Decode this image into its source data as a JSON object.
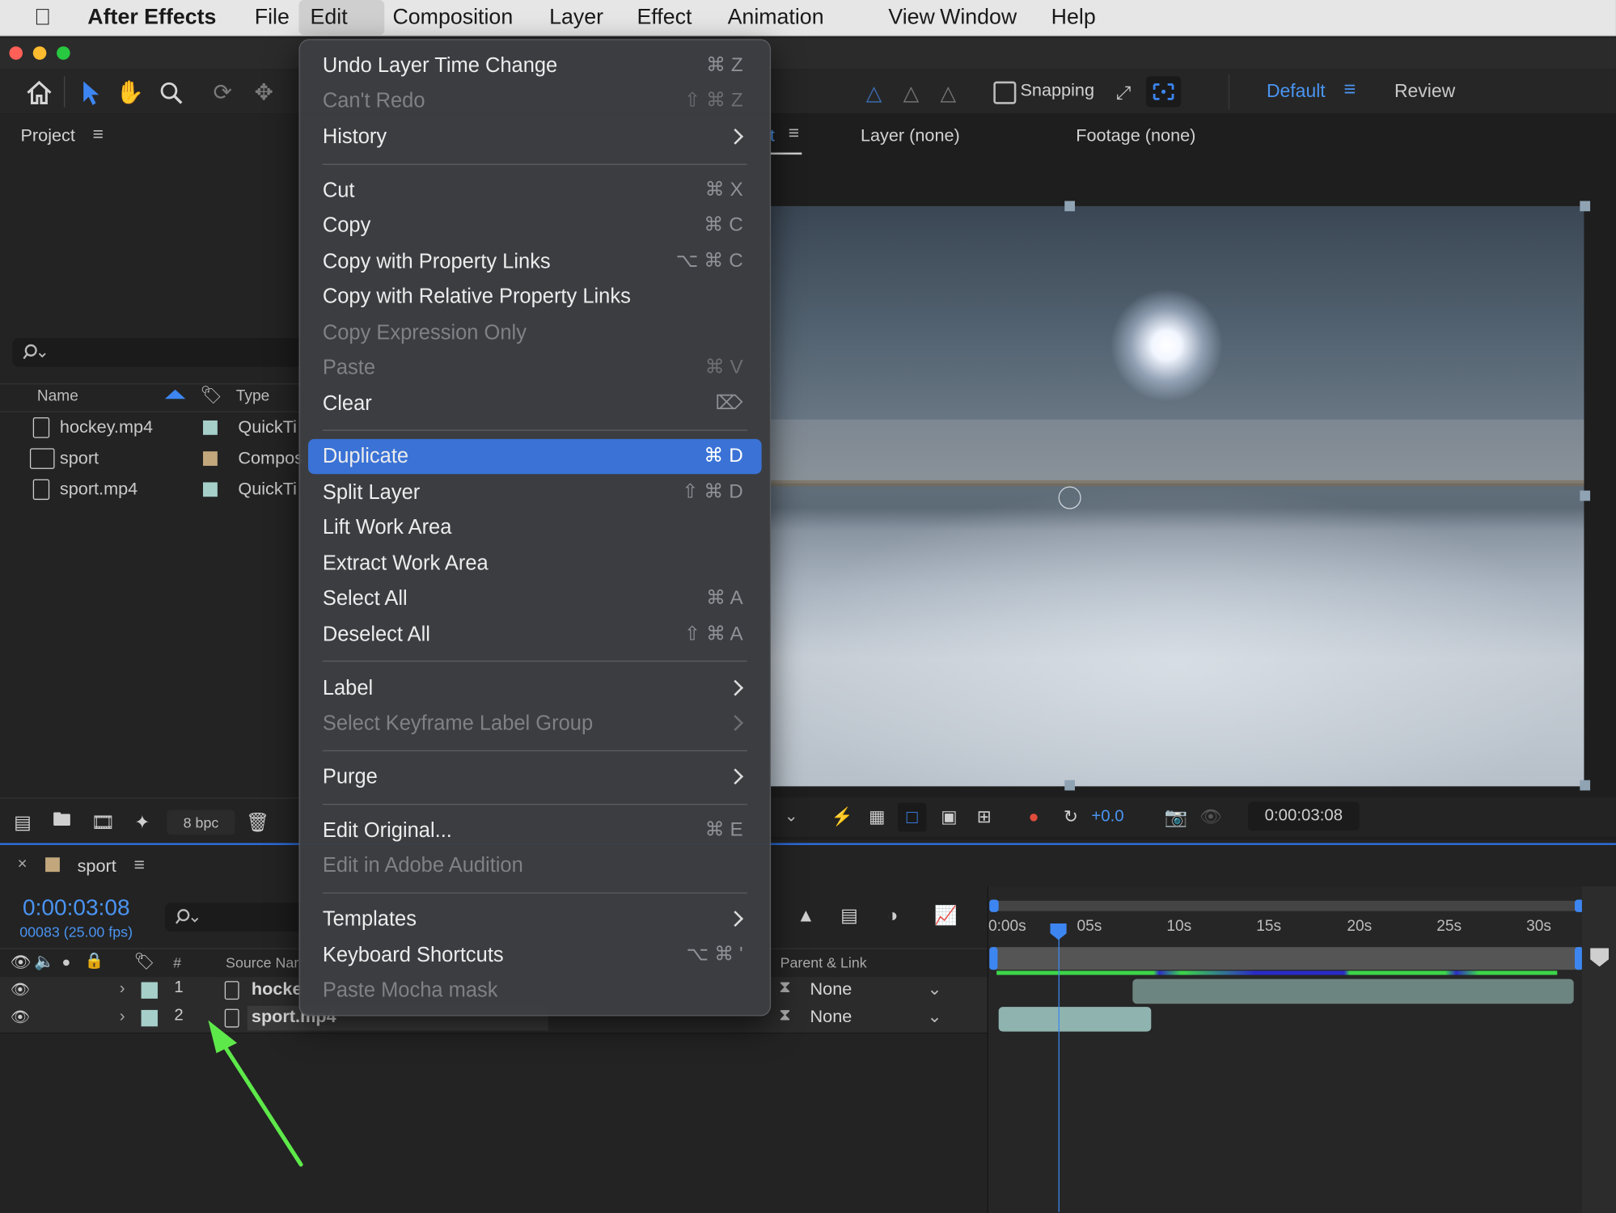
{
  "menubar": {
    "app": "After Effects",
    "items": [
      "File",
      "Edit",
      "Composition",
      "Layer",
      "Effect",
      "Animation",
      "View",
      "Window",
      "Help"
    ]
  },
  "toolbar": {
    "snapping": "Snapping",
    "workspace_default": "Default",
    "workspace_review": "Review"
  },
  "viewer_tabs": {
    "layer": "Layer (none)",
    "footage": "Footage (none)",
    "comp_tab_fragment": "t"
  },
  "project": {
    "title": "Project",
    "columns": {
      "name": "Name",
      "type": "Type"
    },
    "items": [
      {
        "name": "hockey.mp4",
        "type": "QuickTi",
        "color": "#a6cfc9"
      },
      {
        "name": "sport",
        "type": "Compos",
        "color": "#c2a77d"
      },
      {
        "name": "sport.mp4",
        "type": "QuickTi",
        "color": "#a6cfc9"
      }
    ],
    "bpc": "8 bpc"
  },
  "viewer_controls": {
    "exposure": "+0.0",
    "timecode": "0:00:03:08"
  },
  "timeline": {
    "comp_name": "sport",
    "timecode": "0:00:03:08",
    "frames": "00083 (25.00 fps)",
    "col_number": "#",
    "col_source": "Source Nar",
    "col_parent": "Parent & Link",
    "ruler": [
      "0:00s",
      "05s",
      "10s",
      "15s",
      "20s",
      "25s",
      "30s"
    ],
    "layers": [
      {
        "num": "1",
        "name": "hocke",
        "parent": "None"
      },
      {
        "num": "2",
        "name": "sport.mp4",
        "parent": "None"
      }
    ]
  },
  "edit_menu": {
    "items": [
      {
        "label": "Undo Layer Time Change",
        "shortcut": "⌘ Z",
        "disabled": false
      },
      {
        "label": "Can't Redo",
        "shortcut": "⇧ ⌘ Z",
        "disabled": true
      },
      {
        "label": "History",
        "shortcut": "",
        "disabled": false,
        "submenu": true
      },
      {
        "label": "Cut",
        "shortcut": "⌘ X",
        "disabled": false
      },
      {
        "label": "Copy",
        "shortcut": "⌘ C",
        "disabled": false
      },
      {
        "label": "Copy with Property Links",
        "shortcut": "⌥ ⌘ C",
        "disabled": false
      },
      {
        "label": "Copy with Relative Property Links",
        "shortcut": "",
        "disabled": false
      },
      {
        "label": "Copy Expression Only",
        "shortcut": "",
        "disabled": true
      },
      {
        "label": "Paste",
        "shortcut": "⌘ V",
        "disabled": true
      },
      {
        "label": "Clear",
        "shortcut": "⌦",
        "disabled": false
      },
      {
        "label": "Duplicate",
        "shortcut": "⌘ D",
        "disabled": false,
        "highlighted": true
      },
      {
        "label": "Split Layer",
        "shortcut": "⇧ ⌘ D",
        "disabled": false
      },
      {
        "label": "Lift Work Area",
        "shortcut": "",
        "disabled": false
      },
      {
        "label": "Extract Work Area",
        "shortcut": "",
        "disabled": false
      },
      {
        "label": "Select All",
        "shortcut": "⌘ A",
        "disabled": false
      },
      {
        "label": "Deselect All",
        "shortcut": "⇧ ⌘ A",
        "disabled": false
      },
      {
        "label": "Label",
        "shortcut": "",
        "disabled": false,
        "submenu": true
      },
      {
        "label": "Select Keyframe Label Group",
        "shortcut": "",
        "disabled": true,
        "submenu": true
      },
      {
        "label": "Purge",
        "shortcut": "",
        "disabled": false,
        "submenu": true
      },
      {
        "label": "Edit Original...",
        "shortcut": "⌘ E",
        "disabled": false
      },
      {
        "label": "Edit in Adobe Audition",
        "shortcut": "",
        "disabled": true
      },
      {
        "label": "Templates",
        "shortcut": "",
        "disabled": false,
        "submenu": true
      },
      {
        "label": "Keyboard Shortcuts",
        "shortcut": "⌥ ⌘ '",
        "disabled": false
      },
      {
        "label": "Paste Mocha mask",
        "shortcut": "",
        "disabled": true
      }
    ]
  }
}
